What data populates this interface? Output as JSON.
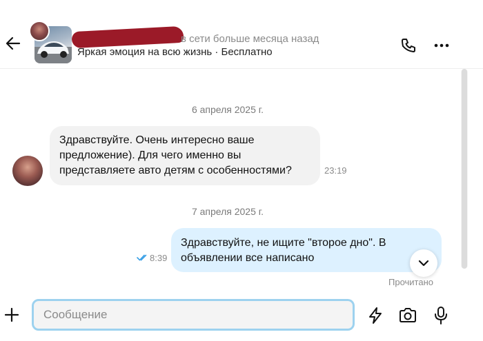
{
  "header": {
    "status": "в сети больше месяца назад",
    "listing_title": "Яркая эмоция на всю жизнь · Бесплатно",
    "icons": {
      "back": "arrow-left-icon",
      "call": "phone-icon",
      "more": "more-horizontal-icon"
    }
  },
  "messages": {
    "date_1": "6 апреля 2025 г.",
    "incoming": {
      "text": "Здравствуйте. Очень интересно ваше предложение). Для чего именно вы представляете авто детям с особенностями?",
      "time": "23:19"
    },
    "date_2": "7 апреля 2025 г.",
    "outgoing": {
      "text": "Здравствуйте, не ищите \"второе дно\". В объявлении все написано",
      "time": "8:39",
      "status": "Прочитано"
    }
  },
  "composer": {
    "placeholder": "Сообщение",
    "value": "",
    "icons": {
      "attach": "plus-icon",
      "quick_reply": "bolt-icon",
      "camera": "camera-icon",
      "voice": "microphone-icon"
    }
  },
  "colors": {
    "incoming_bubble": "#f2f2f2",
    "outgoing_bubble": "#ddf1ff",
    "input_border": "#9dd2ef",
    "read_ticks": "#3aa0e6",
    "redaction": "#9b1a28"
  }
}
